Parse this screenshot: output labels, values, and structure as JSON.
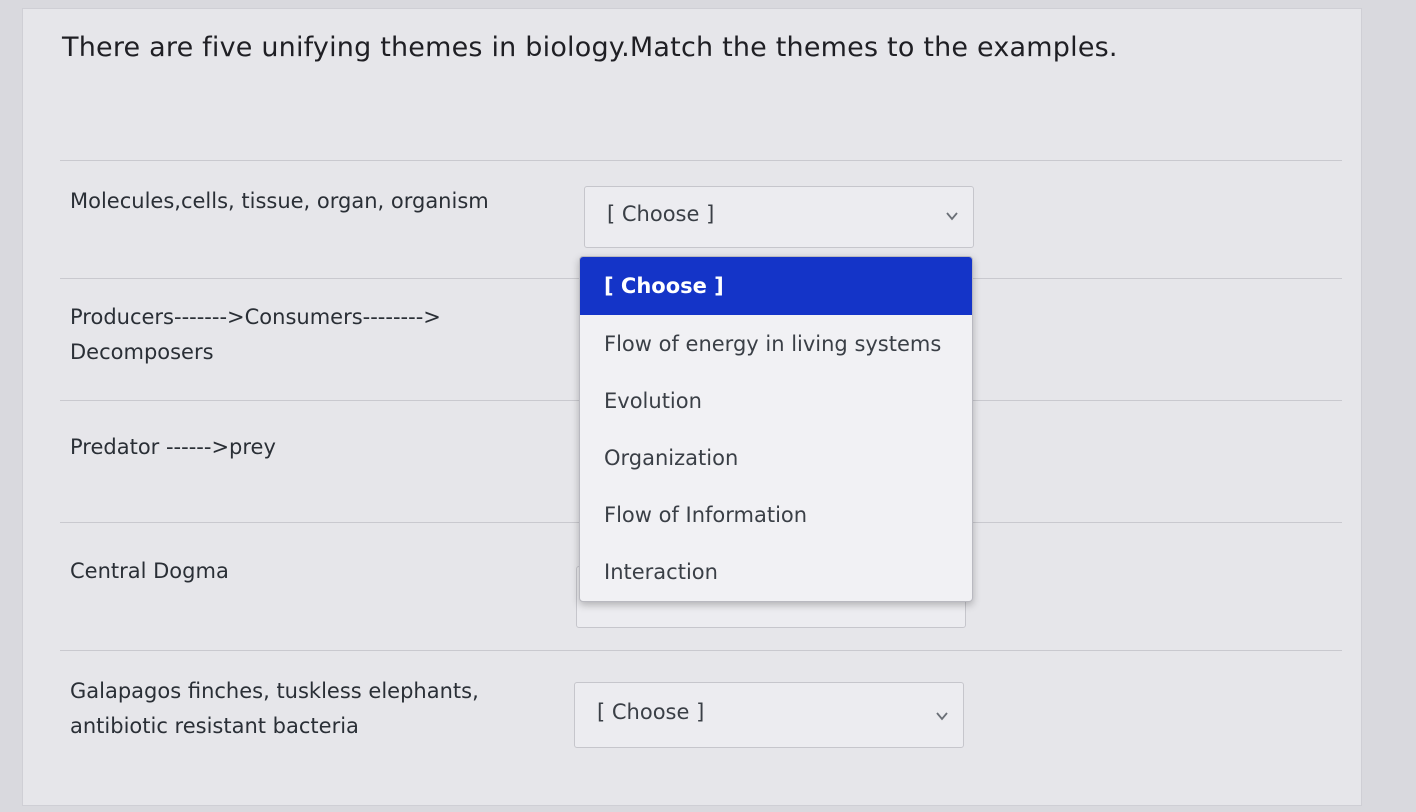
{
  "question": {
    "text": "There are five unifying themes in biology.Match the themes to the examples."
  },
  "rows": [
    {
      "label": "Molecules,cells, tissue, organ, organism",
      "selected": "[ Choose ]"
    },
    {
      "label_line1": "Producers------->Consumers-------->",
      "label_line2": "Decomposers"
    },
    {
      "label": "Predator ------>prey"
    },
    {
      "label": "Central Dogma"
    },
    {
      "label_line1": "Galapagos finches, tuskless elephants,",
      "label_line2": "antibiotic resistant bacteria",
      "selected": "[ Choose ]"
    }
  ],
  "dropdown": {
    "options": [
      "[ Choose ]",
      "Flow of energy in living systems",
      "Evolution",
      "Organization",
      "Flow of Information",
      "Interaction"
    ],
    "highlighted_index": 0
  },
  "colors": {
    "highlight": "#1434c8",
    "page_bg": "#e6e6ea"
  }
}
